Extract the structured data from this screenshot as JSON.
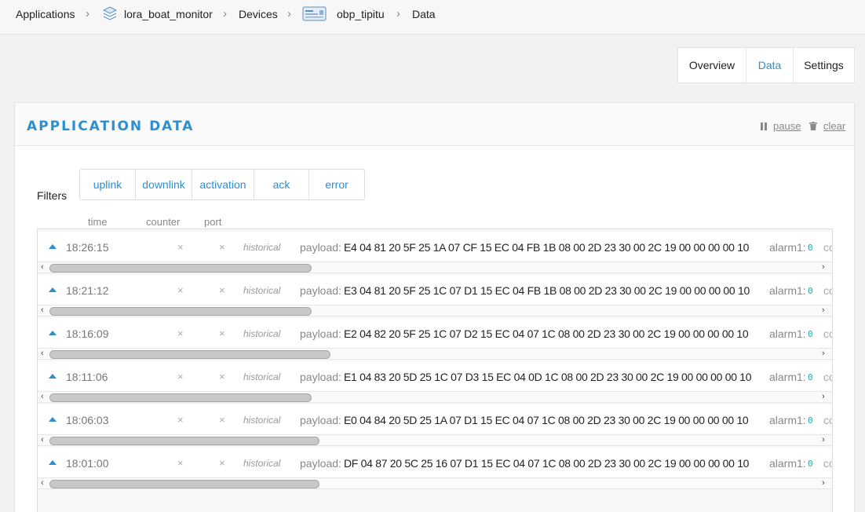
{
  "breadcrumb": {
    "applications": "Applications",
    "app_name": "lora_boat_monitor",
    "devices": "Devices",
    "device_name": "obp_tipitu",
    "current": "Data",
    "separator": "›"
  },
  "tabs": [
    {
      "label": "Overview",
      "active": false
    },
    {
      "label": "Data",
      "active": true
    },
    {
      "label": "Settings",
      "active": false
    }
  ],
  "panel": {
    "title": "APPLICATION DATA",
    "pause_label": "pause",
    "clear_label": "clear"
  },
  "filters": {
    "label": "Filters",
    "options": [
      "uplink",
      "downlink",
      "activation",
      "ack",
      "error"
    ]
  },
  "columns": {
    "time": "time",
    "counter": "counter",
    "port": "port"
  },
  "rows": [
    {
      "time": "18:26:15",
      "counter": "×",
      "port": "×",
      "tag": "historical",
      "payload_label": "payload:",
      "payload": "E4 04 81 20 5F 25 1A 07 CF 15 EC 04 FB 1B 08 00 2D 23 30 00 2C 19 00 00 00 00 10",
      "alarm_label": "alarm1:",
      "alarm_value": "0",
      "cut_text": "co",
      "scroll_fraction": 0.34
    },
    {
      "time": "18:21:12",
      "counter": "×",
      "port": "×",
      "tag": "historical",
      "payload_label": "payload:",
      "payload": "E3 04 81 20 5F 25 1C 07 D1 15 EC 04 FB 1B 08 00 2D 23 30 00 2C 19 00 00 00 00 10",
      "alarm_label": "alarm1:",
      "alarm_value": "0",
      "cut_text": "co",
      "scroll_fraction": 0.34
    },
    {
      "time": "18:16:09",
      "counter": "×",
      "port": "×",
      "tag": "historical",
      "payload_label": "payload:",
      "payload": "E2 04 82 20 5F 25 1C 07 D2 15 EC 04 07 1C 08 00 2D 23 30 00 2C 19 00 00 00 00 10",
      "alarm_label": "alarm1:",
      "alarm_value": "0",
      "cut_text": "co",
      "scroll_fraction": 0.365
    },
    {
      "time": "18:11:06",
      "counter": "×",
      "port": "×",
      "tag": "historical",
      "payload_label": "payload:",
      "payload": "E1 04 83 20 5D 25 1C 07 D3 15 EC 04 0D 1C 08 00 2D 23 30 00 2C 19 00 00 00 00 10",
      "alarm_label": "alarm1:",
      "alarm_value": "0",
      "cut_text": "co",
      "scroll_fraction": 0.34
    },
    {
      "time": "18:06:03",
      "counter": "×",
      "port": "×",
      "tag": "historical",
      "payload_label": "payload:",
      "payload": "E0 04 84 20 5D 25 1A 07 D1 15 EC 04 07 1C 08 00 2D 23 30 00 2C 19 00 00 00 00 10",
      "alarm_label": "alarm1:",
      "alarm_value": "0",
      "cut_text": "co",
      "scroll_fraction": 0.35
    },
    {
      "time": "18:01:00",
      "counter": "×",
      "port": "×",
      "tag": "historical",
      "payload_label": "payload:",
      "payload": "DF 04 87 20 5C 25 16 07 D1 15 EC 04 07 1C 08 00 2D 23 30 00 2C 19 00 00 00 00 10",
      "alarm_label": "alarm1:",
      "alarm_value": "0",
      "cut_text": "co",
      "scroll_fraction": 0.35
    }
  ],
  "colors": {
    "accent": "#2c8fd0",
    "alarm_value": "#2ba3a0"
  },
  "icons": {
    "app": "layers-stack-icon",
    "device": "device-board-icon",
    "pause": "pause-icon",
    "clear": "trash-icon",
    "expand": "caret-up-icon"
  }
}
